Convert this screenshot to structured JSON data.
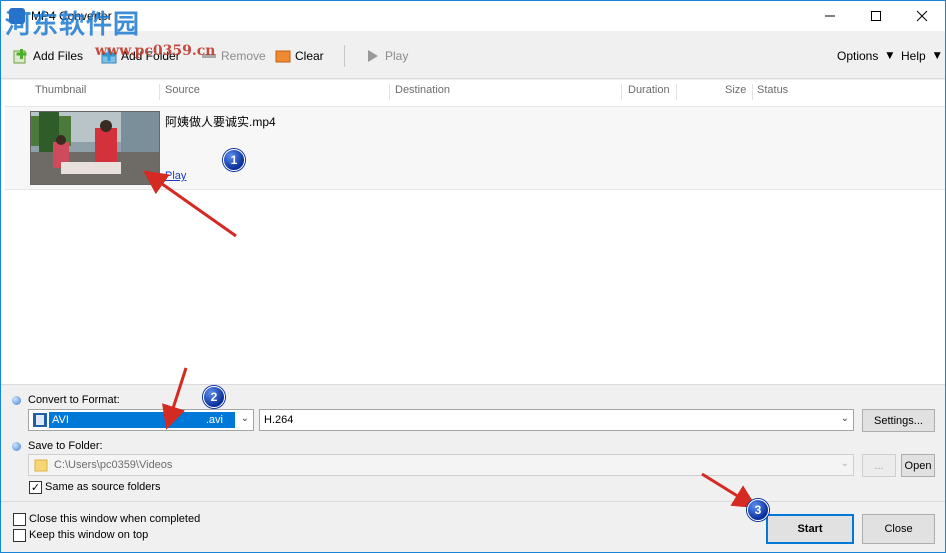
{
  "window": {
    "title": "MP4 Converter",
    "watermark": "河东软件园",
    "watermark_url": "www.pc0359.cn"
  },
  "toolbar": {
    "add_files": "Add Files",
    "add_folder": "Add Folder",
    "remove": "Remove",
    "clear": "Clear",
    "play": "Play",
    "options": "Options",
    "help": "Help"
  },
  "list": {
    "columns": [
      "Thumbnail",
      "Source",
      "Destination",
      "Duration",
      "Size",
      "Status"
    ],
    "items": [
      {
        "file_name": "阿姨做人要诚实.mp4",
        "play_label": "Play"
      }
    ]
  },
  "convert": {
    "label": "Convert to Format:",
    "format": "AVI",
    "extension": ".avi",
    "codec": "H.264",
    "settings_label": "Settings..."
  },
  "save": {
    "label": "Save to Folder:",
    "path": "C:\\Users\\pc0359\\Videos",
    "browse_label": "...",
    "open_label": "Open",
    "same_as_source": "Same as source folders",
    "same_as_source_checked": true
  },
  "footer": {
    "close_when_completed": "Close this window when completed",
    "keep_on_top": "Keep this window on top",
    "start_label": "Start",
    "close_label": "Close"
  },
  "annotations": {
    "badge_1": "1",
    "badge_2": "2",
    "badge_3": "3"
  },
  "colors": {
    "accent": "#0078d7",
    "selection": "#0078d7",
    "annotation_arrow": "#d42a22",
    "badge": "#0a2e9a"
  }
}
